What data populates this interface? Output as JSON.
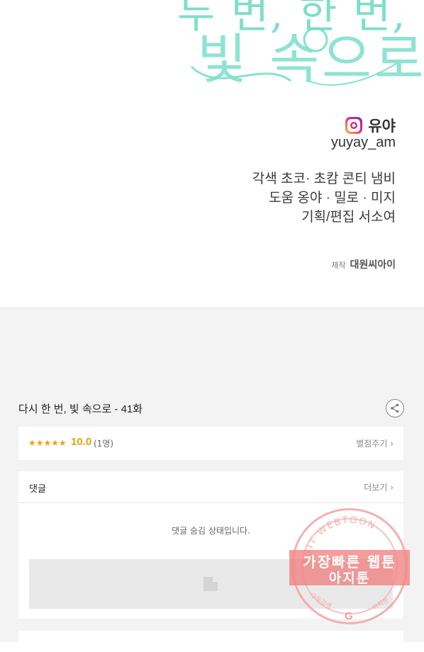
{
  "credits": {
    "title_art_line1": "두 번, 한 번,",
    "title_art_line2": "빛 속으로",
    "instagram": {
      "icon": "instagram-icon",
      "name": "유야",
      "handle": "yuyay_am"
    },
    "lines": [
      "각색 초코· 초캄 콘티 냄비",
      "도움 옹야 · 밀로 · 미지",
      "기획/편집 서소여"
    ],
    "production_label": "제작",
    "production_value": "대원씨아이"
  },
  "episode": {
    "title": "다시 한 번, 빛 속으로 - 41화",
    "share_icon": "share-icon"
  },
  "rating": {
    "stars": "★★★★★",
    "score": "10.0",
    "count": "(1명)",
    "rate_button": "별점주기 ›"
  },
  "comments": {
    "title": "댓글",
    "more_button": "더보기 ›",
    "hidden_message": "댓글 숨김 상태입니다.",
    "placeholder_icon": "image-placeholder-icon"
  },
  "watermark": {
    "arc_text": "AGIT WEBTOON",
    "line1": "가장빠른 웹툰",
    "line2": "아지툰",
    "small_left": "구독검색",
    "small_right": "아지툰",
    "logo": "G",
    "color": "#f07878"
  },
  "colors": {
    "title_art": "#7fe0cc",
    "rating_accent": "#e8a010",
    "viewer_bg": "#f3f3f3"
  }
}
